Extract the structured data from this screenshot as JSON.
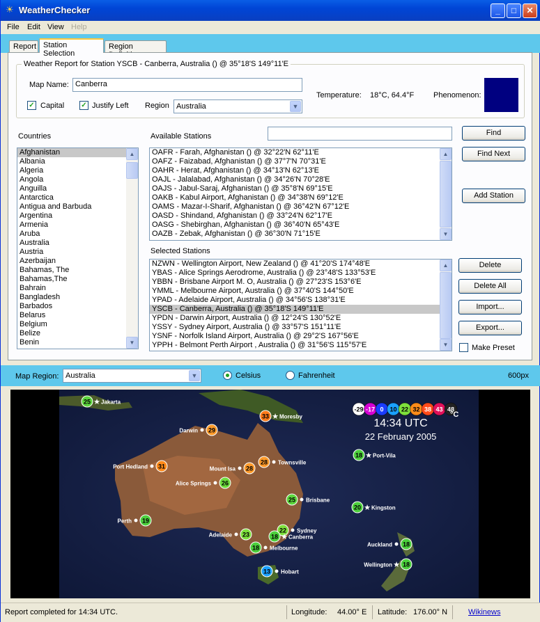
{
  "window": {
    "title": "WeatherChecker"
  },
  "menu": [
    "File",
    "Edit",
    "View",
    "Help"
  ],
  "tabs": [
    "Report",
    "Station Selection",
    "Region Definition"
  ],
  "report": {
    "group_title": "Weather Report for Station YSCB - Canberra, Australia () @ 35°18'S 149°11'E",
    "map_name_label": "Map Name:",
    "map_name_value": "Canberra",
    "capital_label": "Capital",
    "justify_label": "Justify Left",
    "region_label": "Region",
    "region_value": "Australia",
    "temperature_label": "Temperature:",
    "temperature_value": "18°C, 64.4°F",
    "phenomenon_label": "Phenomenon:",
    "phenomenon_color": "#000080"
  },
  "countries": {
    "label": "Countries",
    "items": [
      "Afghanistan",
      "Albania",
      "Algeria",
      "Angola",
      "Anguilla",
      "Antarctica",
      "Antigua and Barbuda",
      "Argentina",
      "Armenia",
      "Aruba",
      "Australia",
      "Austria",
      "Azerbaijan",
      "Bahamas, The",
      "Bahamas,The",
      "Bahrain",
      "Bangladesh",
      "Barbados",
      "Belarus",
      "Belgium",
      "Belize",
      "Benin"
    ]
  },
  "available": {
    "label": "Available Stations",
    "search_value": "",
    "items": [
      "OAFR - Farah, Afghanistan () @ 32°22'N 62°11'E",
      "OAFZ - Faizabad, Afghanistan () @ 37°7'N 70°31'E",
      "OAHR - Herat, Afghanistan () @ 34°13'N 62°13'E",
      "OAJL - Jalalabad, Afghanistan () @ 34°26'N 70°28'E",
      "OAJS - Jabul-Saraj, Afghanistan () @ 35°8'N 69°15'E",
      "OAKB - Kabul Airport, Afghanistan () @ 34°38'N 69°12'E",
      "OAMS - Mazar-I-Sharif, Afghanistan () @ 36°42'N 67°12'E",
      "OASD - Shindand, Afghanistan () @ 33°24'N 62°17'E",
      "OASG - Shebirghan, Afghanistan () @ 36°40'N 65°43'E",
      "OAZB - Zebak, Afghanistan () @ 36°30'N 71°15'E"
    ]
  },
  "selected": {
    "label": "Selected Stations",
    "items": [
      "NZWN - Wellington Airport, New Zealand () @ 41°20'S 174°48'E",
      "YBAS - Alice Springs Aerodrome, Australia () @ 23°48'S 133°53'E",
      "YBBN - Brisbane Airport M. O, Australia () @ 27°23'S 153°6'E",
      "YMML - Melbourne Airport, Australia () @ 37°40'S 144°50'E",
      "YPAD - Adelaide Airport, Australia () @ 34°56'S 138°31'E",
      "YSCB - Canberra, Australia () @ 35°18'S 149°11'E",
      "YPDN - Darwin Airport, Australia () @ 12°24'S 130°52'E",
      "YSSY - Sydney Airport, Australia () @ 33°57'S 151°11'E",
      "YSNF - Norfolk Island Airport, Australia () @ 29°2'S 167°56'E",
      "YPPH - Belmont Perth Airport , Australia () @ 31°56'S 115°57'E"
    ],
    "selected_index": 5
  },
  "buttons": {
    "find": "Find",
    "find_next": "Find Next",
    "add_station": "Add Station",
    "delete": "Delete",
    "delete_all": "Delete All",
    "import": "Import...",
    "export": "Export...",
    "make_preset": "Make Preset"
  },
  "map_controls": {
    "label": "Map Region:",
    "region_value": "Australia",
    "celsius": "Celsius",
    "fahrenheit": "Fahrenheit",
    "size": "600px"
  },
  "map": {
    "time": "14:34 UTC",
    "date": "22 February 2005",
    "unit": "°C",
    "legend": [
      {
        "v": "-29",
        "c": "#ffffff",
        "t": "#000"
      },
      {
        "v": "-17",
        "c": "#d400d4",
        "t": "#fff"
      },
      {
        "v": "0",
        "c": "#1a3cff",
        "t": "#fff"
      },
      {
        "v": "10",
        "c": "#1aa0ff",
        "t": "#000"
      },
      {
        "v": "22",
        "c": "#7ee03c",
        "t": "#000"
      },
      {
        "v": "32",
        "c": "#ff8c1a",
        "t": "#000"
      },
      {
        "v": "38",
        "c": "#ff4a1a",
        "t": "#fff"
      },
      {
        "v": "43",
        "c": "#e0105a",
        "t": "#fff"
      },
      {
        "v": "48",
        "c": "#222222",
        "t": "#fff"
      }
    ],
    "stations": [
      {
        "name": "Jakarta",
        "temp": "25",
        "c": "#5cd63c",
        "capital": true
      },
      {
        "name": "Moresby",
        "temp": "33",
        "c": "#ff7a1a",
        "capital": true
      },
      {
        "name": "Darwin",
        "temp": "29",
        "c": "#ff9a2a",
        "capital": false
      },
      {
        "name": "Port Hedland",
        "temp": "31",
        "c": "#ff8a1a",
        "capital": false
      },
      {
        "name": "Mount Isa",
        "temp": "28",
        "c": "#ff9a2a",
        "capital": false
      },
      {
        "name": "Townsville",
        "temp": "28",
        "c": "#ff9a2a",
        "capital": false
      },
      {
        "name": "Port-Vila",
        "temp": "18",
        "c": "#4ccf3c",
        "capital": true
      },
      {
        "name": "Alice Springs",
        "temp": "26",
        "c": "#6cdc3c",
        "capital": false
      },
      {
        "name": "Brisbane",
        "temp": "25",
        "c": "#5cd63c",
        "capital": false
      },
      {
        "name": "Perth",
        "temp": "19",
        "c": "#4ccf3c",
        "capital": false
      },
      {
        "name": "Kingston",
        "temp": "20",
        "c": "#4ccf3c",
        "capital": true
      },
      {
        "name": "Sydney",
        "temp": "22",
        "c": "#7ee03c",
        "capital": false
      },
      {
        "name": "Adelaide",
        "temp": "23",
        "c": "#7ee03c",
        "capital": false
      },
      {
        "name": "Canberra",
        "temp": "18",
        "c": "#4ccf3c",
        "capital": true
      },
      {
        "name": "Melbourne",
        "temp": "18",
        "c": "#4ccf3c",
        "capital": false
      },
      {
        "name": "Auckland",
        "temp": "18",
        "c": "#4ccf3c",
        "capital": false
      },
      {
        "name": "Wellington",
        "temp": "18",
        "c": "#4ccf3c",
        "capital": true
      },
      {
        "name": "Hobart",
        "temp": "13",
        "c": "#1aa0ff",
        "capital": false
      }
    ]
  },
  "status": {
    "message": "Report completed for 14:34 UTC.",
    "longitude_label": "Longitude:",
    "longitude_value": "44.00° E",
    "latitude_label": "Latitude:",
    "latitude_value": "176.00° N",
    "link": "Wikinews"
  }
}
